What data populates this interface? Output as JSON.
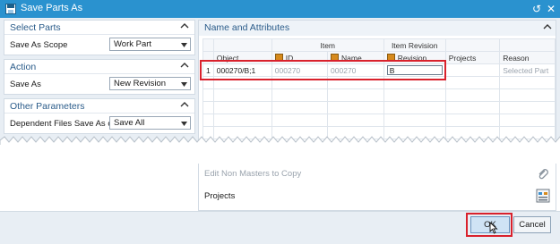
{
  "window": {
    "title": "Save Parts As"
  },
  "left": {
    "select_parts": {
      "header": "Select Parts",
      "save_as_scope_label": "Save As Scope",
      "save_as_scope_value": "Work Part"
    },
    "action": {
      "header": "Action",
      "save_as_label": "Save As",
      "save_as_value": "New Revision"
    },
    "other_parameters": {
      "header": "Other Parameters",
      "dependent_label": "Dependent Files Save As option",
      "dependent_value": "Save All"
    }
  },
  "right": {
    "header": "Name and Attributes",
    "table": {
      "group_headers": {
        "item": "Item",
        "item_revision": "Item Revision"
      },
      "columns": {
        "object": "Object",
        "id": "ID",
        "name": "Name",
        "revision": "Revision",
        "projects": "Projects",
        "reason": "Reason"
      },
      "rows": [
        {
          "index": "1",
          "object": "000270/B;1",
          "id": "000270",
          "name": "000270",
          "revision": "B",
          "projects": "",
          "reason": "Selected Part"
        }
      ]
    }
  },
  "lower": {
    "edit_non_masters": "Edit Non Masters to Copy",
    "projects": "Projects"
  },
  "buttons": {
    "ok": "OK",
    "cancel": "Cancel"
  },
  "colors": {
    "titlebar": "#2a92cf",
    "highlight": "#d9212c",
    "section_header_text": "#2b5c8a"
  }
}
